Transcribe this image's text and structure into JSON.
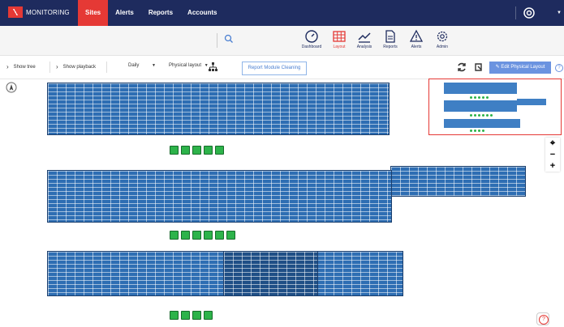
{
  "app": {
    "logo_text": "MONITORING"
  },
  "nav": [
    {
      "label": "Sites",
      "active": true
    },
    {
      "label": "Alerts",
      "active": false
    },
    {
      "label": "Reports",
      "active": false
    },
    {
      "label": "Accounts",
      "active": false
    }
  ],
  "tools": [
    {
      "label": "Dashboard",
      "icon": "dashboard-icon",
      "active": false
    },
    {
      "label": "Layout",
      "icon": "layout-icon",
      "active": true
    },
    {
      "label": "Analysis",
      "icon": "analysis-icon",
      "active": false
    },
    {
      "label": "Reports",
      "icon": "reports-icon",
      "active": false
    },
    {
      "label": "Alerts",
      "icon": "alerts-icon",
      "active": false
    },
    {
      "label": "Admin",
      "icon": "admin-icon",
      "active": false
    }
  ],
  "controls": {
    "show_tree": "Show tree",
    "show_playback": "Show playback",
    "period": "Daily",
    "layout_mode": "Physical layout",
    "report_btn": "Report Module Cleaning",
    "edit_btn": "Edit Physical Layout",
    "help": "?"
  },
  "zoom": {
    "plus": "+",
    "minus": "−"
  },
  "colors": {
    "nav_bg": "#1e2b5e",
    "accent": "#e53935",
    "panel": "#2e6eb3",
    "meter": "#2db34a"
  },
  "meters": {
    "row1_count": 5,
    "row2_count": 6,
    "row3_count": 4
  }
}
